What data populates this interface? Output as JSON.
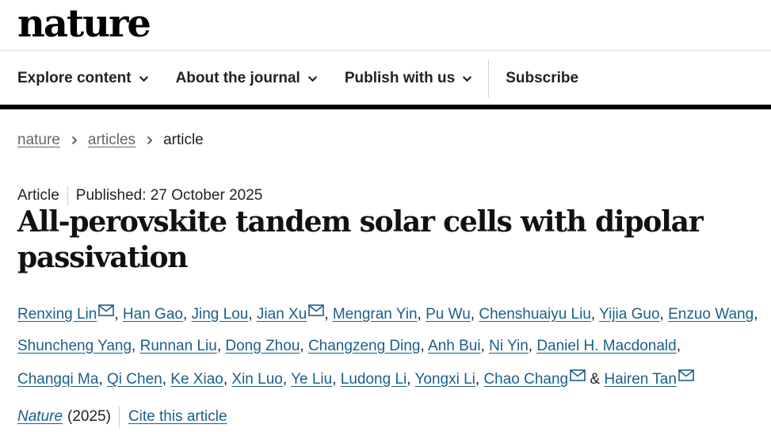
{
  "site": {
    "logo": "nature"
  },
  "nav": {
    "items": [
      {
        "label": "Explore content",
        "icon": "chevron-down-icon"
      },
      {
        "label": "About the journal",
        "icon": "chevron-down-icon"
      },
      {
        "label": "Publish with us",
        "icon": "chevron-down-icon"
      }
    ],
    "subscribe_label": "Subscribe"
  },
  "breadcrumb": {
    "items": [
      "nature",
      "articles"
    ],
    "current": "article"
  },
  "article": {
    "type": "Article",
    "published": "Published: 27 October 2025",
    "title": "All-perovskite tandem solar cells with dipolar passivation",
    "authors": [
      {
        "name": "Renxing Lin",
        "email": true
      },
      {
        "name": "Han Gao",
        "email": false
      },
      {
        "name": "Jing Lou",
        "email": false
      },
      {
        "name": "Jian Xu",
        "email": true
      },
      {
        "name": "Mengran Yin",
        "email": false
      },
      {
        "name": "Pu Wu",
        "email": false
      },
      {
        "name": "Chenshuaiyu Liu",
        "email": false
      },
      {
        "name": "Yijia Guo",
        "email": false
      },
      {
        "name": "Enzuo Wang",
        "email": false
      },
      {
        "name": "Shuncheng Yang",
        "email": false
      },
      {
        "name": "Runnan Liu",
        "email": false
      },
      {
        "name": "Dong Zhou",
        "email": false
      },
      {
        "name": "Changzeng Ding",
        "email": false
      },
      {
        "name": "Anh Bui",
        "email": false
      },
      {
        "name": "Ni Yin",
        "email": false
      },
      {
        "name": "Daniel H. Macdonald",
        "email": false
      },
      {
        "name": "Changqi Ma",
        "email": false
      },
      {
        "name": "Qi Chen",
        "email": false
      },
      {
        "name": "Ke Xiao",
        "email": false
      },
      {
        "name": "Xin Luo",
        "email": false
      },
      {
        "name": "Ye Liu",
        "email": false
      },
      {
        "name": "Ludong Li",
        "email": false
      },
      {
        "name": "Yongxi Li",
        "email": false
      },
      {
        "name": "Chao Chang",
        "email": true
      },
      {
        "name": "Hairen Tan",
        "email": true
      }
    ],
    "journal": "Nature",
    "year": "(2025)",
    "cite_label": "Cite this article"
  },
  "colors": {
    "link": "#1a5f8a",
    "text": "#222222",
    "nav_bar": "#000000"
  }
}
